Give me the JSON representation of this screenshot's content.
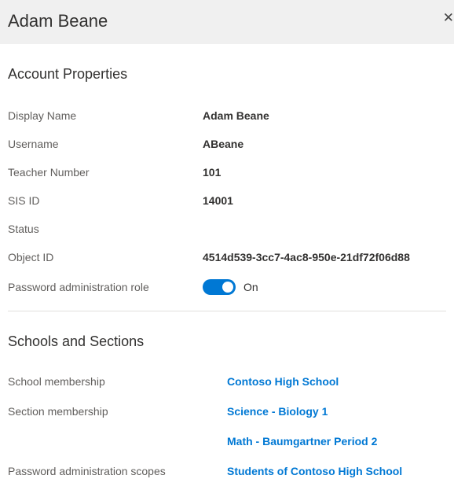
{
  "header": {
    "title": "Adam Beane"
  },
  "accountProperties": {
    "sectionTitle": "Account Properties",
    "displayName": {
      "label": "Display Name",
      "value": "Adam Beane"
    },
    "username": {
      "label": "Username",
      "value": "ABeane"
    },
    "teacherNumber": {
      "label": "Teacher Number",
      "value": "101"
    },
    "sisId": {
      "label": "SIS ID",
      "value": "14001"
    },
    "status": {
      "label": "Status",
      "value": ""
    },
    "objectId": {
      "label": "Object ID",
      "value": "4514d539-3cc7-4ac8-950e-21df72f06d88"
    },
    "passwordAdminRole": {
      "label": "Password administration role",
      "state": "On",
      "enabled": true
    }
  },
  "schoolsAndSections": {
    "sectionTitle": "Schools and Sections",
    "schoolMembership": {
      "label": "School membership",
      "value": "Contoso High School"
    },
    "sectionMembership": {
      "label": "Section membership",
      "values": [
        "Science - Biology 1",
        "Math - Baumgartner Period 2"
      ]
    },
    "passwordAdminScopes": {
      "label": "Password administration scopes",
      "value": "Students of Contoso High School"
    }
  },
  "colors": {
    "link": "#0078d4",
    "toggleOn": "#0078d4"
  }
}
